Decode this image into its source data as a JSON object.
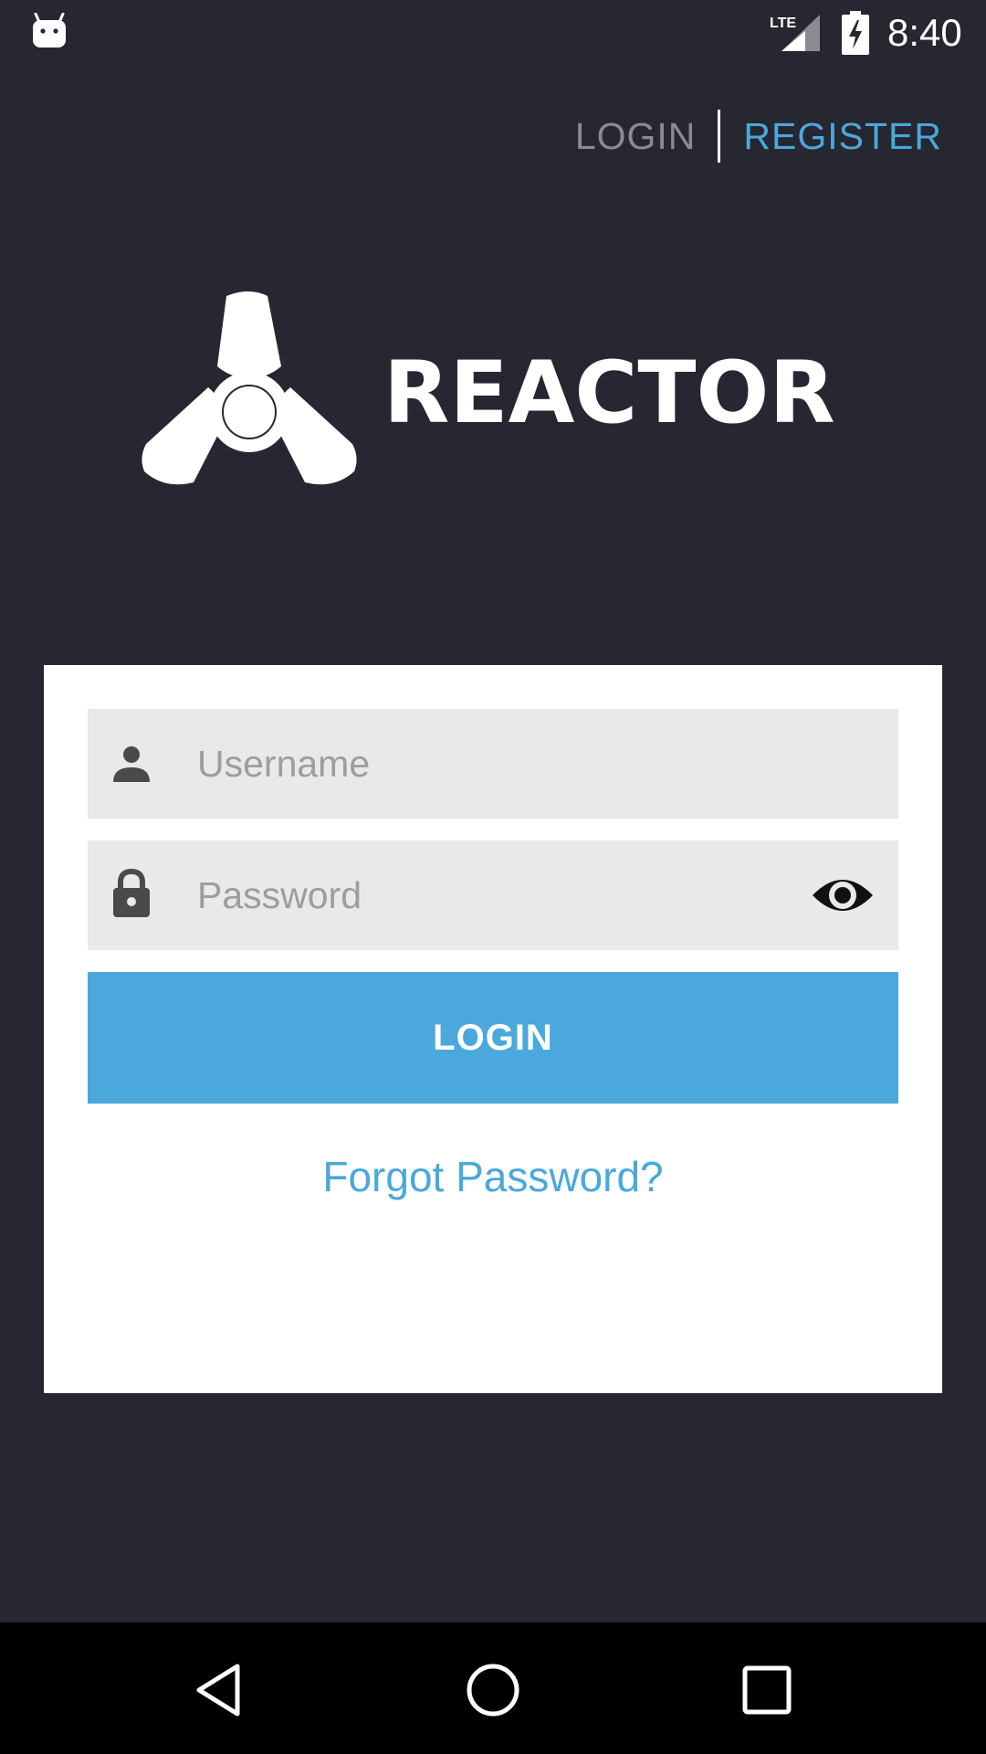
{
  "status_bar": {
    "time": "8:40",
    "network_label": "LTE",
    "icons": [
      "android-icon",
      "lte-signal-icon",
      "battery-charging-icon"
    ]
  },
  "auth_tabs": {
    "login_label": "LOGIN",
    "register_label": "REGISTER",
    "active": "register"
  },
  "logo": {
    "wordmark": "REACTOR",
    "icon": "reactor-trefoil-logo"
  },
  "form": {
    "username": {
      "placeholder": "Username",
      "value": "",
      "icon": "person-icon"
    },
    "password": {
      "placeholder": "Password",
      "value": "",
      "icon": "lock-icon",
      "toggle_icon": "eye-icon"
    },
    "login_button_label": "LOGIN",
    "forgot_password_label": "Forgot Password?"
  },
  "nav_bar": {
    "buttons": [
      "back-icon",
      "home-icon",
      "recents-icon"
    ]
  },
  "colors": {
    "background": "#262730",
    "accent": "#4aa8dc",
    "card": "#ffffff",
    "field": "#e9e9e9",
    "inactive_tab": "#8a8b90"
  }
}
